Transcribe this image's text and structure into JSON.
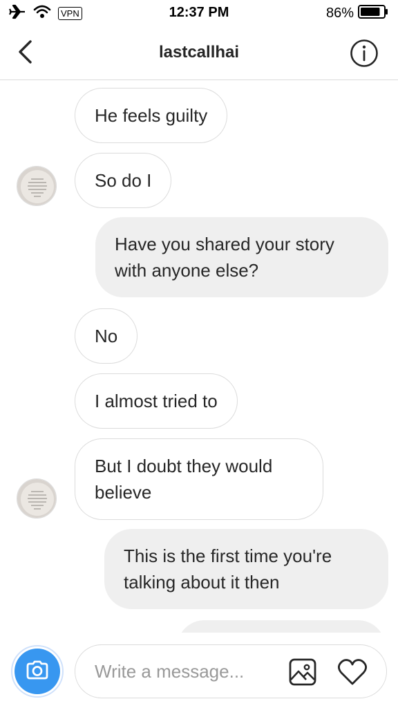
{
  "status_bar": {
    "vpn_label": "VPN",
    "time": "12:37 PM",
    "battery_percent": "86%",
    "battery_level": 0.86,
    "icons": [
      "airplane-icon",
      "wifi-icon",
      "battery-icon"
    ]
  },
  "header": {
    "title": "lastcallhai",
    "back_icon": "chevron-left-icon",
    "info_icon": "info-icon"
  },
  "messages": [
    {
      "direction": "incoming",
      "text": "He feels guilty"
    },
    {
      "direction": "incoming",
      "text": "So do I"
    },
    {
      "direction": "outgoing",
      "text": "Have you shared your story with anyone else?"
    },
    {
      "direction": "incoming",
      "text": "No"
    },
    {
      "direction": "incoming",
      "text": "I almost tried to"
    },
    {
      "direction": "incoming",
      "text": "But I doubt they would believe"
    },
    {
      "direction": "outgoing",
      "text": "This is the first time you're talking about it then"
    }
  ],
  "composer": {
    "placeholder": "Write a message...",
    "camera_icon": "camera-icon",
    "gallery_icon": "gallery-icon",
    "heart_icon": "heart-icon"
  },
  "colors": {
    "accent": "#3897f0",
    "outgoing_bubble": "#efefef",
    "border": "#dbdbdb",
    "text": "#262626",
    "placeholder": "#999999"
  }
}
